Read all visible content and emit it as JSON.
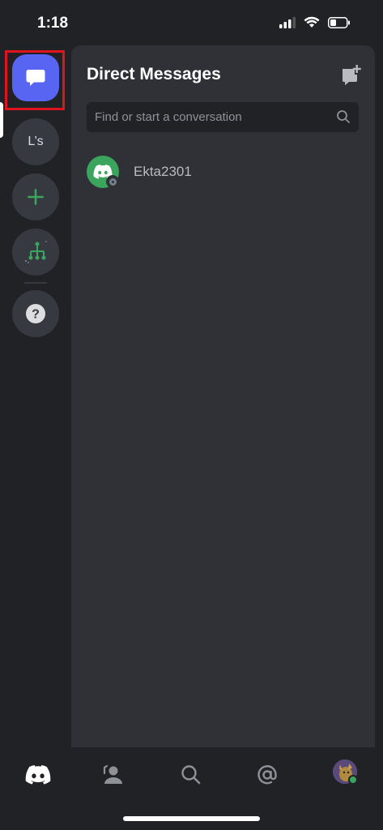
{
  "status_bar": {
    "time": "1:18"
  },
  "rail": {
    "servers": [
      {
        "label": "L’s"
      }
    ]
  },
  "main": {
    "title": "Direct Messages",
    "search_placeholder": "Find or start a conversation",
    "dms": [
      {
        "name": "Ekta2301"
      }
    ]
  },
  "colors": {
    "brand": "#5865f2",
    "online": "#3ba55d",
    "highlight_box": "#e0141e"
  }
}
